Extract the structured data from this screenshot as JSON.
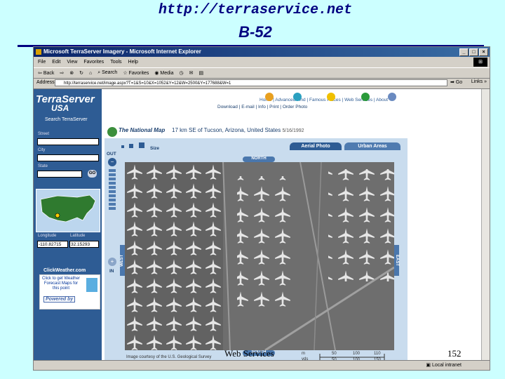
{
  "slide": {
    "title_url": "http://terraservice.net",
    "title_sub": "B-52",
    "caption": "Web Services",
    "page_number": "152"
  },
  "browser": {
    "window_title": "Microsoft TerraServer Imagery - Microsoft Internet Explorer",
    "menu": [
      "File",
      "Edit",
      "View",
      "Favorites",
      "Tools",
      "Help"
    ],
    "toolbar": {
      "back": "Back",
      "search": "Search",
      "favorites": "Favorites",
      "media": "Media"
    },
    "address_label": "Address",
    "address_value": "http://terraservice.net/image.aspx?T=1&S=10&X=1052&Y=12&W=2500&Y=177688&W=1",
    "go_label": "Go",
    "links_label": "Links",
    "status_zone": "Local intranet"
  },
  "page": {
    "brand_line1": "TerraServer",
    "brand_line2": "USA",
    "search_title": "Search TerraServer",
    "street_label": "Street",
    "city_label": "City",
    "state_label": "State",
    "go_button": "GO",
    "longitude_label": "Longitude",
    "latitude_label": "Latitude",
    "longitude_value": "-110.82715",
    "latitude_value": "32.15293",
    "clickweather_title": "ClickWeather.com",
    "clickweather_text": "Click to get Weather Forecast Maps for this point",
    "powered_by": "Powered by",
    "topnav": [
      "Home",
      "Advanced Find",
      "Famous Places",
      "Web Services",
      "About"
    ],
    "national_map": "The National Map",
    "location": "17 km SE of Tucson, Arizona, United States",
    "image_date": "5/16/1992",
    "doc_links": [
      "Download",
      "E-mail",
      "Info",
      "Print",
      "Order Photo"
    ],
    "size_label": "Size",
    "tab_aerial": "Aerial Photo",
    "tab_urban": "Urban Areas",
    "zoom_out": "OUT",
    "zoom_in": "IN",
    "north": "NORTH",
    "south": "SOUTH",
    "west": "WEST",
    "east": "EAST",
    "courtesy": "Image courtesy of the U.S. Geological Survey",
    "scale_units": [
      "m",
      "yds"
    ],
    "scale_m": [
      "50",
      "100",
      "110"
    ],
    "scale_yds": [
      "50",
      "100",
      "150"
    ]
  },
  "colors": {
    "slide_bg": "#ccffff",
    "title": "#000080",
    "nav_blue": "#2e5c94"
  }
}
